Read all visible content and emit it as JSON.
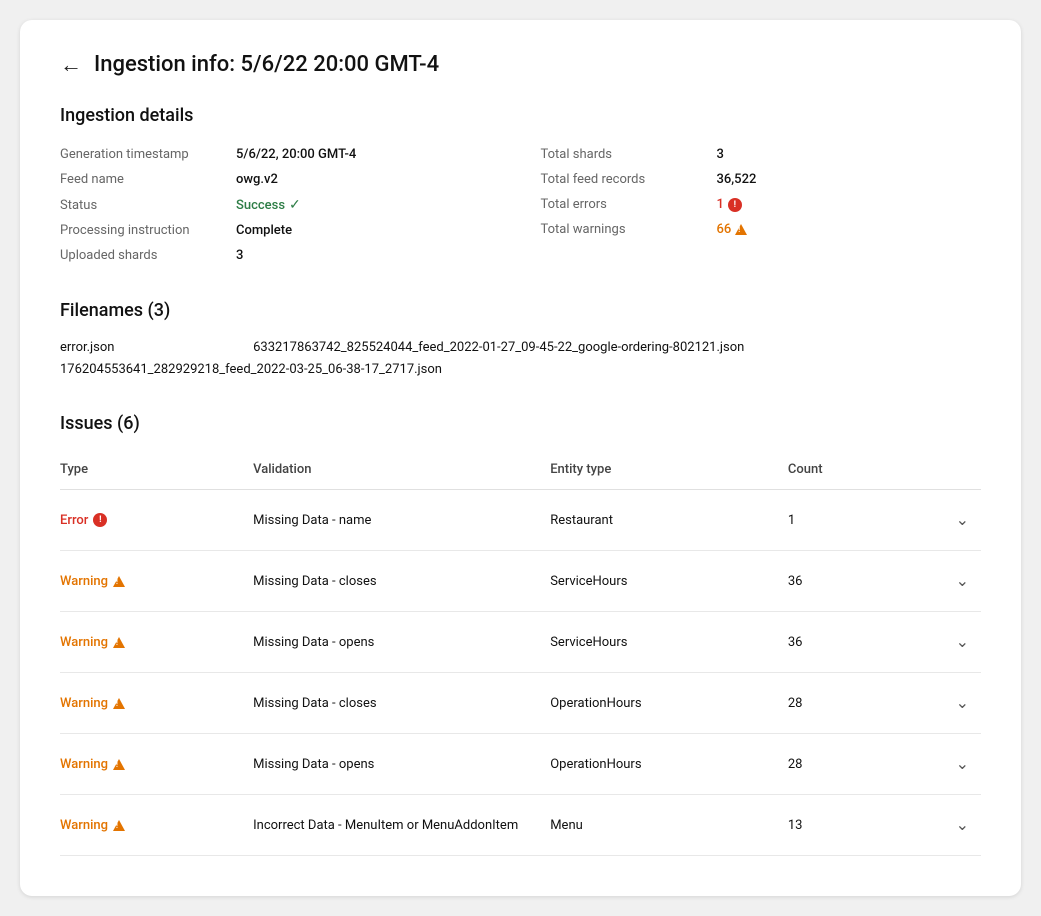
{
  "page": {
    "title": "Ingestion info: 5/6/22 20:00 GMT-4",
    "back_label": "←"
  },
  "details": {
    "section_title": "Ingestion details",
    "left": [
      {
        "label": "Generation timestamp",
        "value": "5/6/22, 20:00 GMT-4",
        "bold": true
      },
      {
        "label": "Feed name",
        "value": "owg.v2",
        "bold": true
      },
      {
        "label": "Status",
        "value": "Success",
        "type": "success"
      },
      {
        "label": "Processing instruction",
        "value": "Complete",
        "bold": true
      },
      {
        "label": "Uploaded shards",
        "value": "3",
        "bold": true
      }
    ],
    "right": [
      {
        "label": "Total shards",
        "value": "3",
        "bold": true
      },
      {
        "label": "Total feed records",
        "value": "36,522",
        "bold": true
      },
      {
        "label": "Total errors",
        "value": "1",
        "type": "error"
      },
      {
        "label": "Total warnings",
        "value": "66",
        "type": "warning"
      }
    ]
  },
  "filenames": {
    "section_title": "Filenames (3)",
    "files": [
      "error.json",
      "633217863742_825524044_feed_2022-01-27_09-45-22_google-ordering-802121.json",
      "176204553641_282929218_feed_2022-03-25_06-38-17_2717.json"
    ]
  },
  "issues": {
    "section_title": "Issues (6)",
    "columns": [
      "Type",
      "Validation",
      "Entity type",
      "Count"
    ],
    "rows": [
      {
        "type": "Error",
        "type_kind": "error",
        "validation": "Missing Data - name",
        "entity_type": "Restaurant",
        "count": "1"
      },
      {
        "type": "Warning",
        "type_kind": "warning",
        "validation": "Missing Data - closes",
        "entity_type": "ServiceHours",
        "count": "36"
      },
      {
        "type": "Warning",
        "type_kind": "warning",
        "validation": "Missing Data - opens",
        "entity_type": "ServiceHours",
        "count": "36"
      },
      {
        "type": "Warning",
        "type_kind": "warning",
        "validation": "Missing Data - closes",
        "entity_type": "OperationHours",
        "count": "28"
      },
      {
        "type": "Warning",
        "type_kind": "warning",
        "validation": "Missing Data - opens",
        "entity_type": "OperationHours",
        "count": "28"
      },
      {
        "type": "Warning",
        "type_kind": "warning",
        "validation": "Incorrect Data - MenuItem or MenuAddonItem",
        "entity_type": "Menu",
        "count": "13"
      }
    ]
  }
}
